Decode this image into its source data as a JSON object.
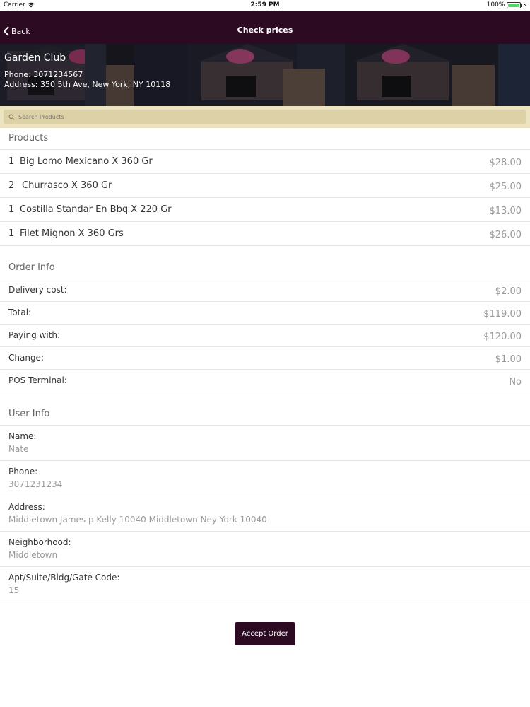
{
  "status_bar": {
    "carrier": "Carrier",
    "time": "2:59 PM",
    "battery": "100%"
  },
  "nav": {
    "back_label": "Back",
    "title": "Check prices"
  },
  "venue": {
    "name": "Garden Club",
    "phone": "Phone: 3071234567",
    "address": "Address: 350 5th Ave, New York, NY 10118"
  },
  "search": {
    "placeholder": "Search Products"
  },
  "products": {
    "title": "Products",
    "items": [
      {
        "qty": "1",
        "name": "Big Lomo Mexicano X 360 Gr",
        "price": "$28.00"
      },
      {
        "qty": "2",
        "name": "Churrasco X 360 Gr",
        "price": "$25.00"
      },
      {
        "qty": "1",
        "name": "Costilla Standar En Bbq X 220 Gr",
        "price": "$13.00"
      },
      {
        "qty": "1",
        "name": "Filet Mignon X 360 Grs",
        "price": "$26.00"
      }
    ]
  },
  "order_info": {
    "title": "Order Info",
    "rows": [
      {
        "label": "Delivery cost:",
        "value": "$2.00"
      },
      {
        "label": "Total:",
        "value": "$119.00"
      },
      {
        "label": "Paying with:",
        "value": "$120.00"
      },
      {
        "label": "Change:",
        "value": "$1.00"
      },
      {
        "label": "POS Terminal:",
        "value": "No"
      }
    ]
  },
  "user_info": {
    "title": "User Info",
    "rows": [
      {
        "label": "Name:",
        "value": "Nate"
      },
      {
        "label": "Phone:",
        "value": "3071231234"
      },
      {
        "label": "Address:",
        "value": "Middletown James p Kelly 10040 Middletown Ney York 10040"
      },
      {
        "label": "Neighborhood:",
        "value": "Middletown"
      },
      {
        "label": "Apt/Suite/Bldg/Gate Code:",
        "value": "15"
      }
    ]
  },
  "actions": {
    "accept_label": "Accept Order"
  },
  "colors": {
    "brand": "#2b0a22",
    "search_strip": "#ece3c1",
    "value_text": "#999999"
  }
}
